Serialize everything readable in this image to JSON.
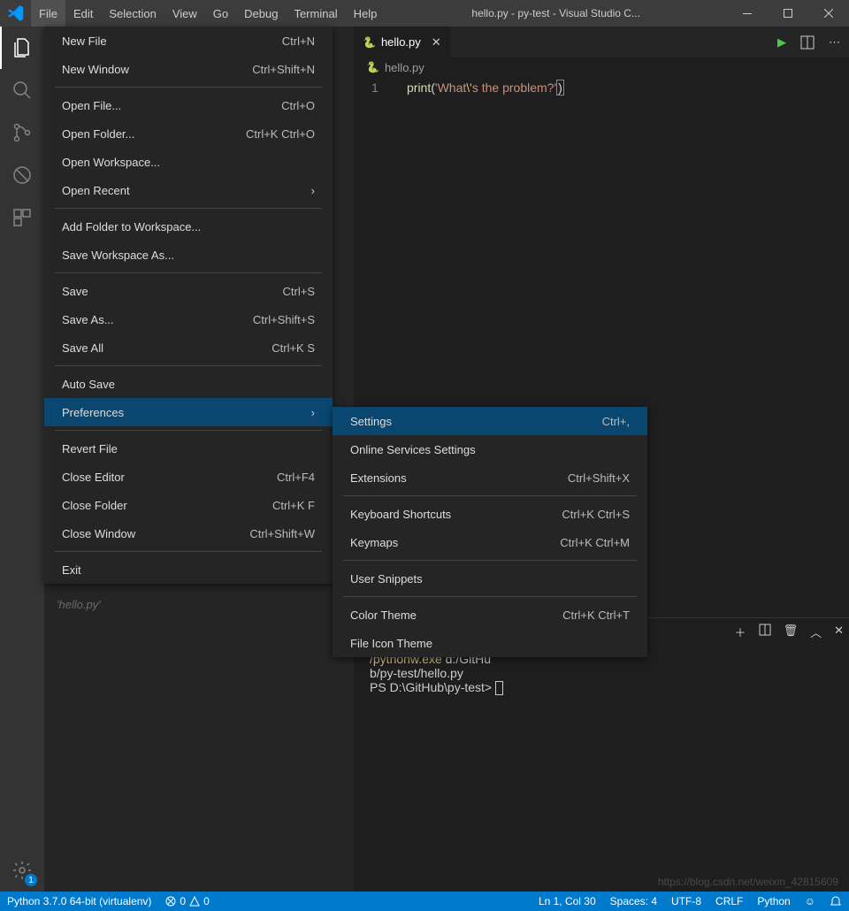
{
  "title": "hello.py - py-test - Visual Studio C...",
  "menus": [
    "File",
    "Edit",
    "Selection",
    "View",
    "Go",
    "Debug",
    "Terminal",
    "Help"
  ],
  "fileMenu": [
    {
      "type": "item",
      "label": "New File",
      "shortcut": "Ctrl+N"
    },
    {
      "type": "item",
      "label": "New Window",
      "shortcut": "Ctrl+Shift+N"
    },
    {
      "type": "sep"
    },
    {
      "type": "item",
      "label": "Open File...",
      "shortcut": "Ctrl+O"
    },
    {
      "type": "item",
      "label": "Open Folder...",
      "shortcut": "Ctrl+K Ctrl+O"
    },
    {
      "type": "item",
      "label": "Open Workspace...",
      "shortcut": ""
    },
    {
      "type": "item",
      "label": "Open Recent",
      "shortcut": "",
      "submenu": true
    },
    {
      "type": "sep"
    },
    {
      "type": "item",
      "label": "Add Folder to Workspace...",
      "shortcut": ""
    },
    {
      "type": "item",
      "label": "Save Workspace As...",
      "shortcut": ""
    },
    {
      "type": "sep"
    },
    {
      "type": "item",
      "label": "Save",
      "shortcut": "Ctrl+S"
    },
    {
      "type": "item",
      "label": "Save As...",
      "shortcut": "Ctrl+Shift+S"
    },
    {
      "type": "item",
      "label": "Save All",
      "shortcut": "Ctrl+K S"
    },
    {
      "type": "sep"
    },
    {
      "type": "item",
      "label": "Auto Save",
      "shortcut": ""
    },
    {
      "type": "item",
      "label": "Preferences",
      "shortcut": "",
      "submenu": true,
      "highlighted": true
    },
    {
      "type": "sep"
    },
    {
      "type": "item",
      "label": "Revert File",
      "shortcut": ""
    },
    {
      "type": "item",
      "label": "Close Editor",
      "shortcut": "Ctrl+F4"
    },
    {
      "type": "item",
      "label": "Close Folder",
      "shortcut": "Ctrl+K F"
    },
    {
      "type": "item",
      "label": "Close Window",
      "shortcut": "Ctrl+Shift+W"
    },
    {
      "type": "sep"
    },
    {
      "type": "item",
      "label": "Exit",
      "shortcut": ""
    }
  ],
  "prefSubmenu": [
    {
      "type": "item",
      "label": "Settings",
      "shortcut": "Ctrl+,",
      "highlighted": true
    },
    {
      "type": "item",
      "label": "Online Services Settings",
      "shortcut": ""
    },
    {
      "type": "item",
      "label": "Extensions",
      "shortcut": "Ctrl+Shift+X"
    },
    {
      "type": "sep"
    },
    {
      "type": "item",
      "label": "Keyboard Shortcuts",
      "shortcut": "Ctrl+K Ctrl+S"
    },
    {
      "type": "item",
      "label": "Keymaps",
      "shortcut": "Ctrl+K Ctrl+M"
    },
    {
      "type": "sep"
    },
    {
      "type": "item",
      "label": "User Snippets",
      "shortcut": ""
    },
    {
      "type": "sep"
    },
    {
      "type": "item",
      "label": "Color Theme",
      "shortcut": "Ctrl+K Ctrl+T"
    },
    {
      "type": "item",
      "label": "File Icon Theme",
      "shortcut": ""
    }
  ],
  "tab": {
    "name": "hello.py"
  },
  "breadcrumb": "hello.py",
  "code": {
    "lineNum": "1",
    "fn": "print",
    "open": "(",
    "q1": "'",
    "s1": "What",
    "esc": "\\'",
    "s2": "s the problem?",
    "q2": "'",
    "close": ")"
  },
  "terminal": {
    "exePath": "/pythonw.exe",
    "exeArg": " d:/GitHu",
    "line2": "b/py-test/hello.py",
    "prompt": "PS D:\\GitHub\\py-test> "
  },
  "sidebarHint": "'hello.py'",
  "status": {
    "python": "Python 3.7.0 64-bit (virtualenv)",
    "errors": "0",
    "warnings": "0",
    "pos": "Ln 1, Col 30",
    "spaces": "Spaces: 4",
    "encoding": "UTF-8",
    "eol": "CRLF",
    "lang": "Python",
    "feedback": "☺"
  },
  "badge": "1",
  "watermark": "https://blog.csdn.net/weixin_42815609"
}
